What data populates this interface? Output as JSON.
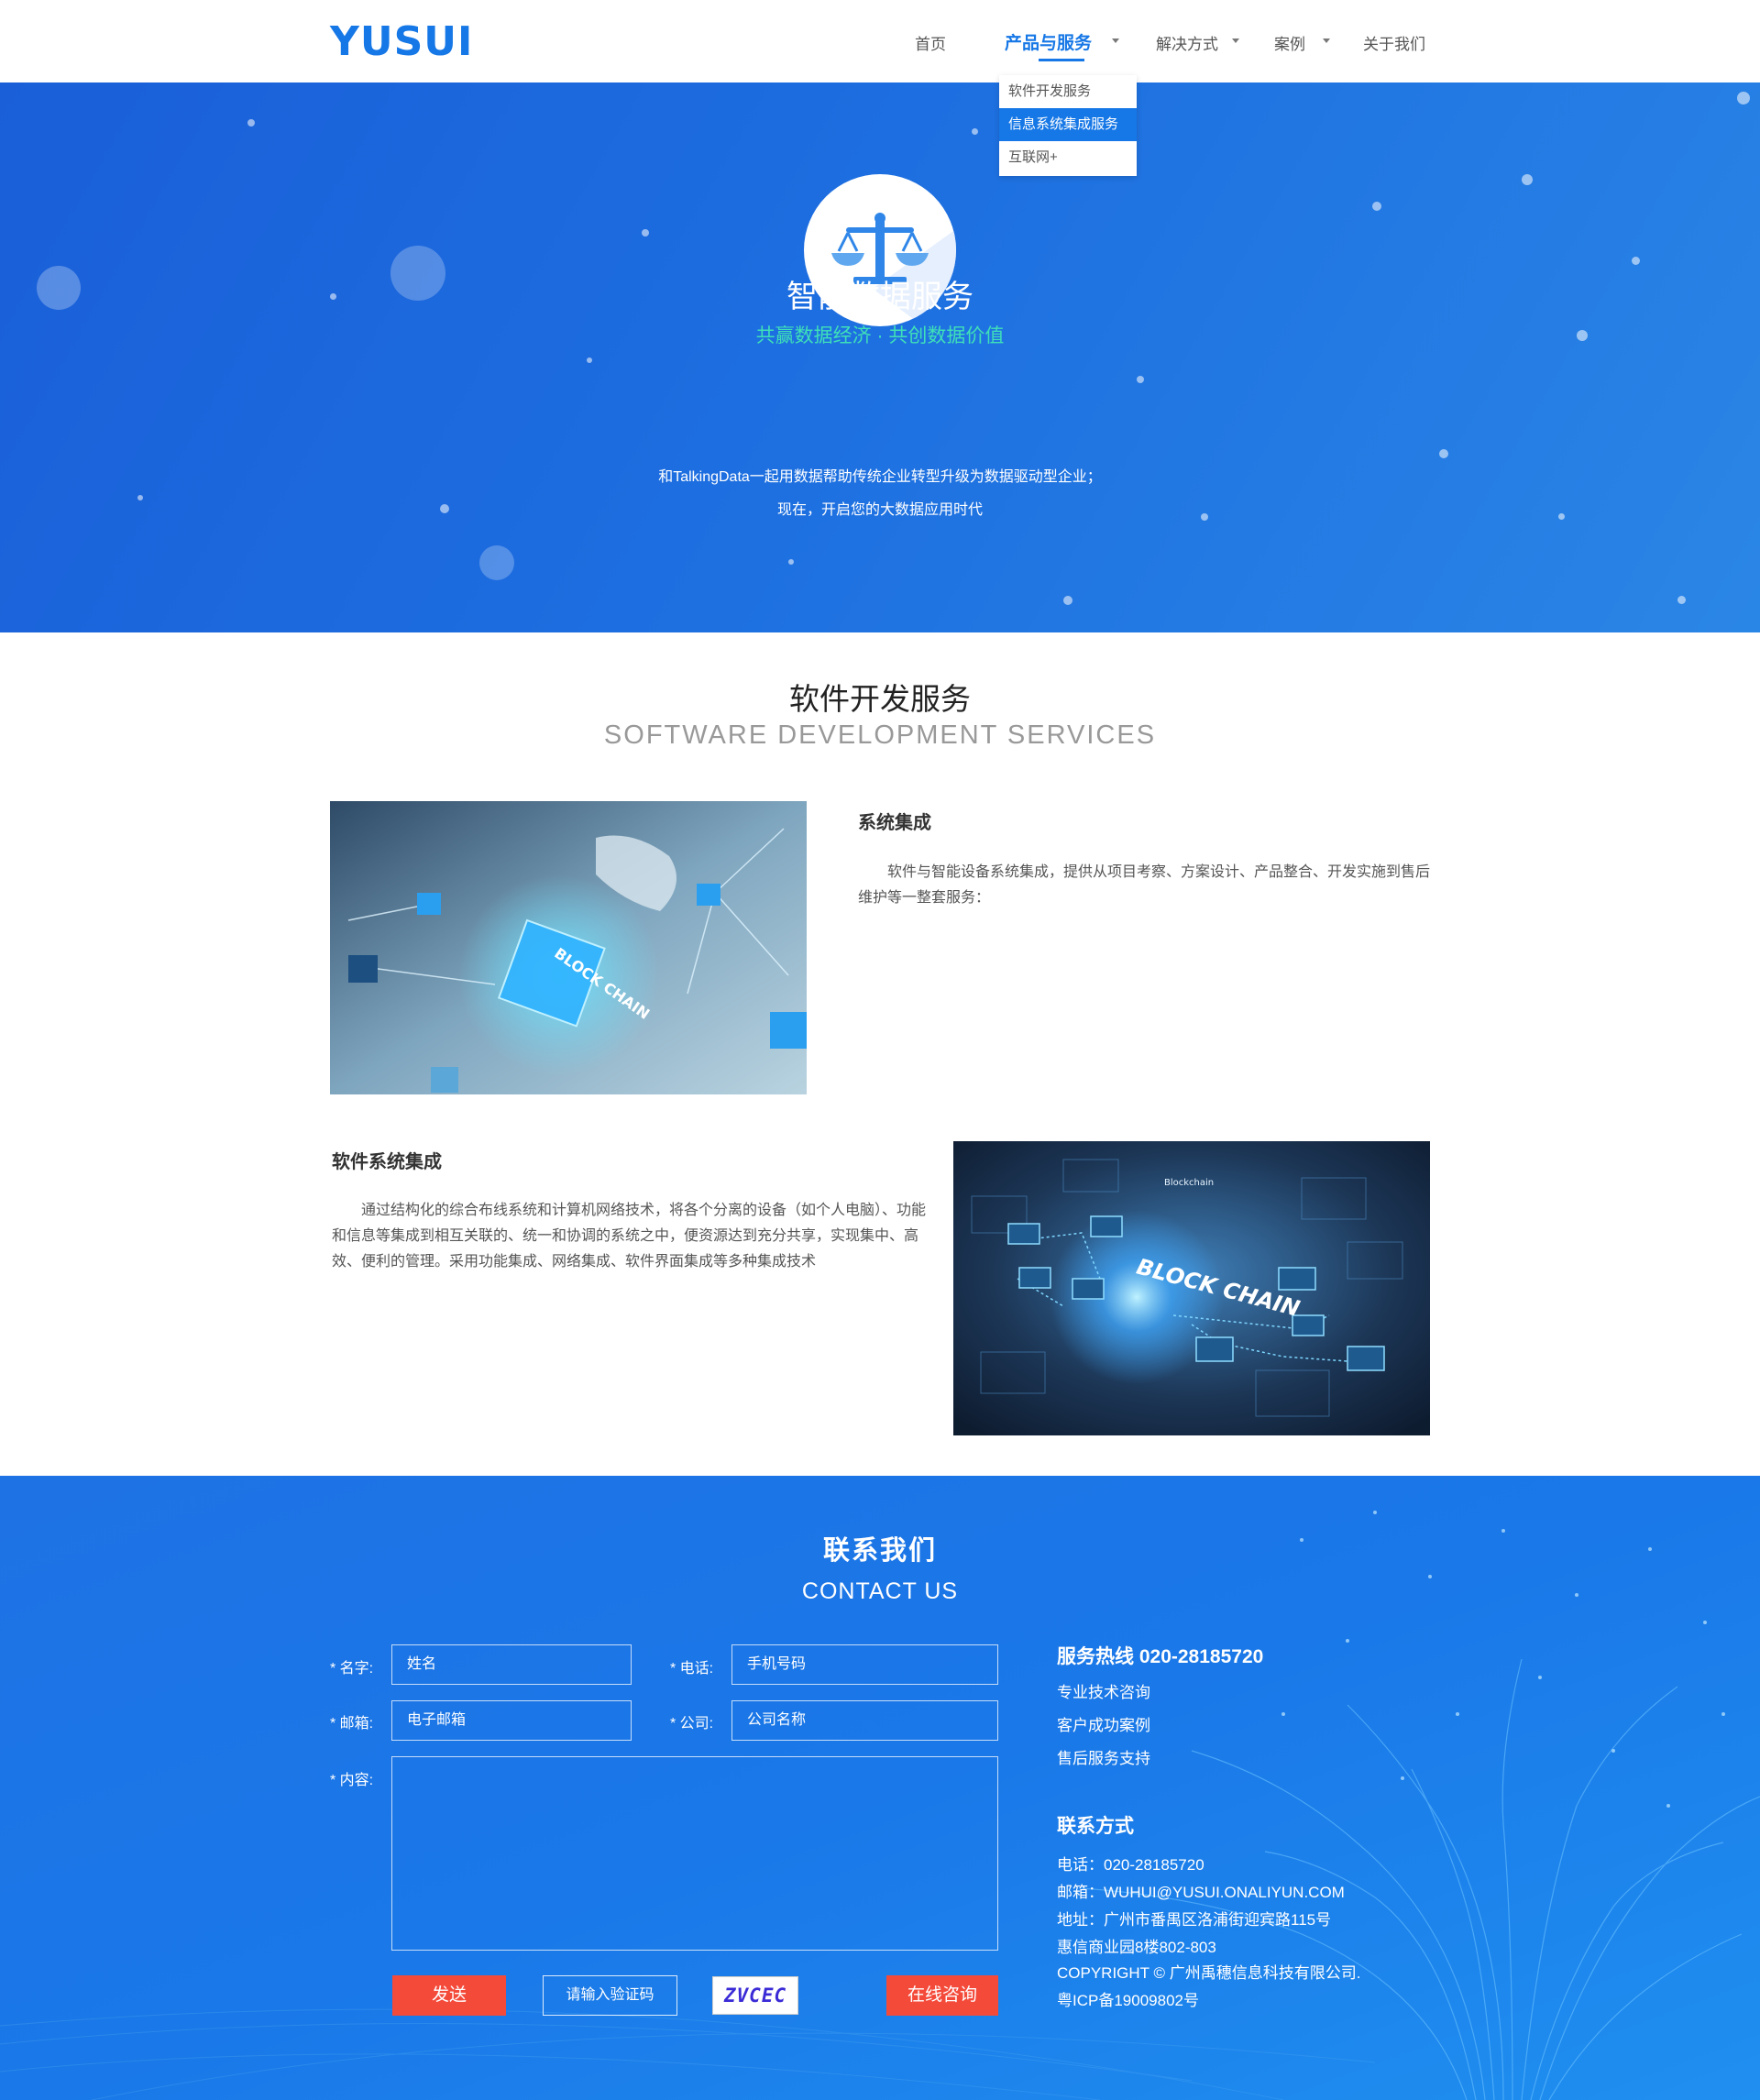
{
  "header": {
    "logo": "YUSUI",
    "nav": [
      {
        "label": "首页"
      },
      {
        "label": "产品与服务"
      },
      {
        "label": "解决方式"
      },
      {
        "label": "案例"
      },
      {
        "label": "关于我们"
      }
    ],
    "active_nav": "产品与服务",
    "dropdown": [
      "软件开发服务",
      "信息系统集成服务",
      "互联网+"
    ],
    "dropdown_selected": "信息系统集成服务"
  },
  "hero": {
    "icon": "scale-icon",
    "title": "智能数据服务",
    "subtitle": "共赢数据经济 · 共创数据价值",
    "desc_line1": "和TalkingData一起用数据帮助传统企业转型升级为数据驱动型企业；",
    "desc_line2": "现在，开启您的大数据应用时代"
  },
  "services": {
    "title": "软件开发服务",
    "subtitle": "SOFTWARE DEVELOPMENT SERVICES",
    "items": [
      {
        "title": "系统集成",
        "text": "软件与智能设备系统集成，提供从项目考察、方案设计、产品整合、开发实施到售后维护等一整套服务：",
        "image_text": "BLOCK CHAIN"
      },
      {
        "title": "软件系统集成",
        "text": "通过结构化的综合布线系统和计算机网络技术，将各个分离的设备（如个人电脑）、功能和信息等集成到相互关联的、统一和协调的系统之中，便资源达到充分共享，实现集中、高效、便利的管理。采用功能集成、网络集成、软件界面集成等多种集成技术",
        "image_text": "BLOCK CHAIN",
        "image_caption": "Blockchain"
      }
    ]
  },
  "contact": {
    "title": "联系我们",
    "subtitle": "CONTACT US",
    "form": {
      "name_label": "* 名字:",
      "name_placeholder": "姓名",
      "phone_label": "* 电话:",
      "phone_placeholder": "手机号码",
      "email_label": "* 邮箱:",
      "email_placeholder": "电子邮箱",
      "company_label": "* 公司:",
      "company_placeholder": "公司名称",
      "content_label": "* 内容:",
      "send_label": "发送",
      "captcha_placeholder": "请输入验证码",
      "captcha_text": "ZVCEC",
      "online_label": "在线咨询"
    },
    "hotline": "服务热线 020-28185720",
    "links": [
      "专业技术咨询",
      "客户成功案例",
      "售后服务支持"
    ],
    "info_title": "联系方式",
    "info": [
      "电话：020-28185720",
      "邮箱：WUHUI@YUSUI.ONALIYUN.COM",
      "地址：广州市番禺区洛浦街迎宾路115号",
      "惠信商业园8楼802-803",
      "COPYRIGHT © 广州禹穗信息科技有限公司.",
      "粤ICP备19009802号"
    ]
  },
  "colors": {
    "brand": "#1677e6",
    "accent_green": "#3fe0b8",
    "button_red": "#f44a3a"
  }
}
